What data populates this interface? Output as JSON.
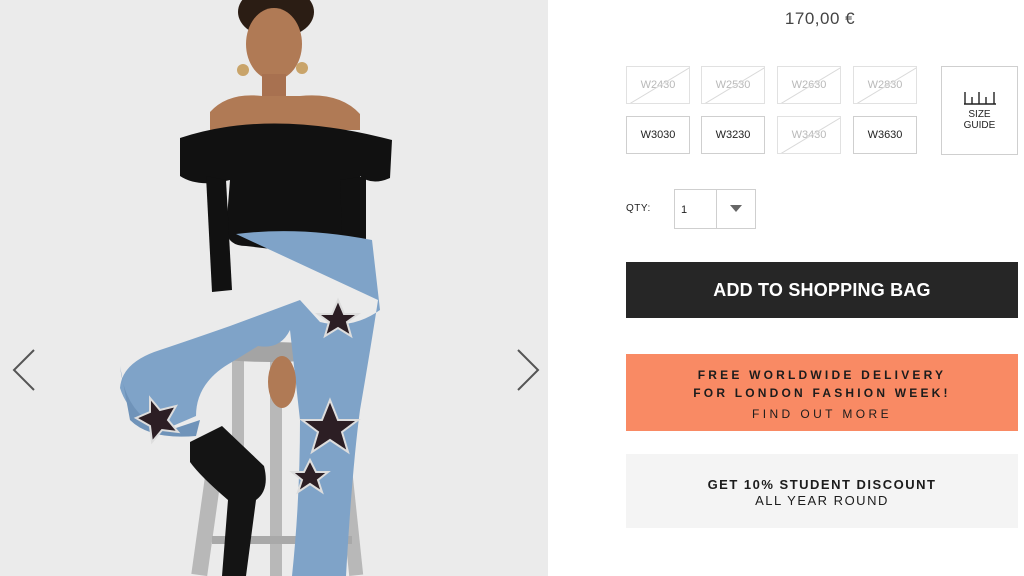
{
  "product": {
    "price": "170,00 €",
    "image_alt": "Model wearing black off-shoulder velvet top and star-patched blue jeans, seated on a stool"
  },
  "gallery": {
    "prev_icon": "chevron-left-icon",
    "next_icon": "chevron-right-icon"
  },
  "sizes": [
    {
      "label": "W2430",
      "available": false
    },
    {
      "label": "W2530",
      "available": false
    },
    {
      "label": "W2630",
      "available": false
    },
    {
      "label": "W2830",
      "available": false
    },
    {
      "label": "W3030",
      "available": true
    },
    {
      "label": "W3230",
      "available": true
    },
    {
      "label": "W3430",
      "available": false
    },
    {
      "label": "W3630",
      "available": true
    }
  ],
  "size_guide": {
    "label": "SIZE\nGUIDE",
    "icon": "ruler-icon"
  },
  "quantity": {
    "label": "QTY:",
    "value": "1",
    "icon": "chevron-down-icon"
  },
  "add_to_bag": {
    "label": "ADD TO SHOPPING BAG"
  },
  "promo": {
    "line1": "FREE WORLDWIDE DELIVERY",
    "line2": "FOR LONDON FASHION WEEK!",
    "link": "FIND OUT MORE",
    "color": "#f98a64"
  },
  "student": {
    "line1": "GET 10% STUDENT DISCOUNT",
    "line2": "ALL YEAR ROUND"
  },
  "colors": {
    "button_bg": "#262626",
    "promo_bg": "#f98a64",
    "student_bg": "#f4f4f4"
  }
}
